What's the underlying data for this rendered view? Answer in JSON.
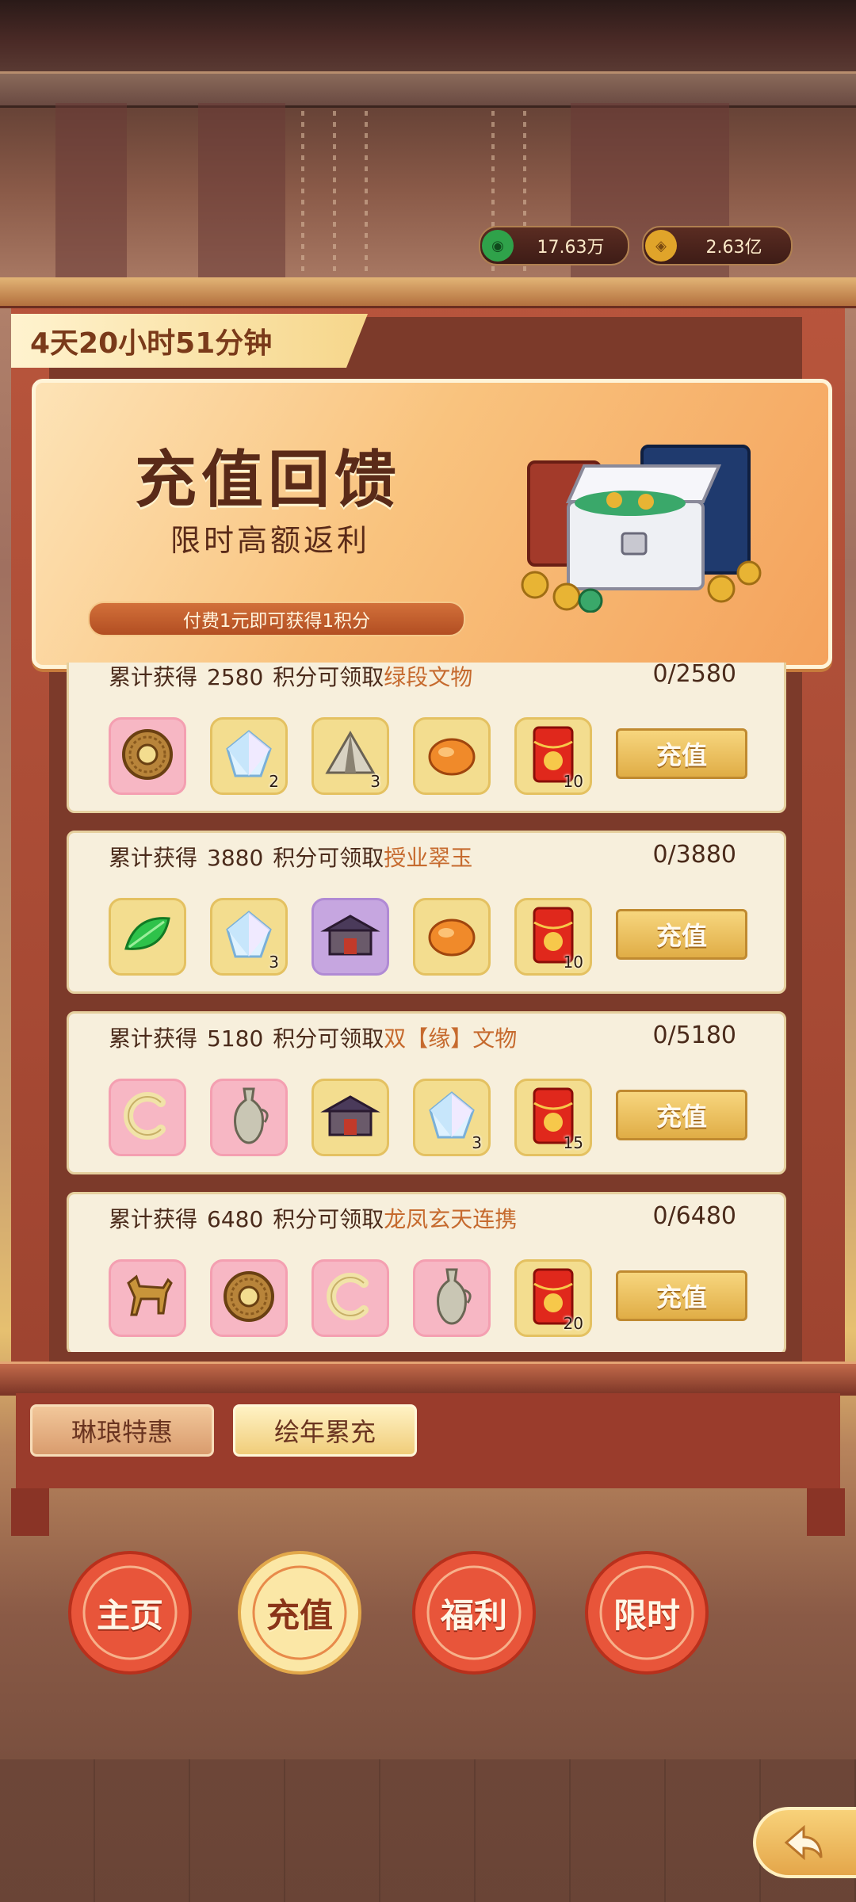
{
  "currencies": [
    {
      "icon": "jade-coin-icon",
      "value": "17.63万",
      "color": "#2fa24a"
    },
    {
      "icon": "gold-coin-icon",
      "value": "2.63亿",
      "color": "#e0a42a"
    }
  ],
  "timer": "4天20小时51分钟",
  "banner": {
    "title": "充值回馈",
    "subtitle": "限时高额返利",
    "rule": "付费1元即可获得1积分"
  },
  "cards": [
    {
      "prefix": "累计获得",
      "points": "2580",
      "mid": "积分可领取",
      "reward": "绿段文物",
      "progress": "0/2580",
      "button": "充值",
      "items": [
        {
          "type": "pink",
          "icon": "bronze-disc-icon",
          "count": ""
        },
        {
          "type": "gold",
          "icon": "crystal-icon",
          "count": "2"
        },
        {
          "type": "gold",
          "icon": "tent-icon",
          "count": "3"
        },
        {
          "type": "gold",
          "icon": "amber-icon",
          "count": ""
        },
        {
          "type": "gold",
          "icon": "red-envelope-icon",
          "count": "10"
        }
      ]
    },
    {
      "prefix": "累计获得",
      "points": "3880",
      "mid": "积分可领取",
      "reward": "授业翠玉",
      "progress": "0/3880",
      "button": "充值",
      "items": [
        {
          "type": "gold",
          "icon": "jade-leaf-icon",
          "count": ""
        },
        {
          "type": "gold",
          "icon": "crystal-icon",
          "count": "3"
        },
        {
          "type": "purple",
          "icon": "building-icon",
          "count": ""
        },
        {
          "type": "gold",
          "icon": "amber-icon",
          "count": ""
        },
        {
          "type": "gold",
          "icon": "red-envelope-icon",
          "count": "10"
        }
      ]
    },
    {
      "prefix": "累计获得",
      "points": "5180",
      "mid": "积分可领取",
      "reward": "双【缘】文物",
      "progress": "0/5180",
      "button": "充值",
      "items": [
        {
          "type": "pink",
          "icon": "jade-ring-icon",
          "count": ""
        },
        {
          "type": "pink",
          "icon": "vase-icon",
          "count": ""
        },
        {
          "type": "gold",
          "icon": "building-icon",
          "count": ""
        },
        {
          "type": "gold",
          "icon": "crystal-icon",
          "count": "3"
        },
        {
          "type": "gold",
          "icon": "red-envelope-icon",
          "count": "15"
        }
      ]
    },
    {
      "prefix": "累计获得",
      "points": "6480",
      "mid": "积分可领取",
      "reward": "龙凤玄天连携",
      "progress": "0/6480",
      "button": "充值",
      "items": [
        {
          "type": "pink",
          "icon": "bronze-horse-icon",
          "count": ""
        },
        {
          "type": "pink",
          "icon": "bronze-disc-icon",
          "count": ""
        },
        {
          "type": "pink",
          "icon": "jade-ring-icon",
          "count": ""
        },
        {
          "type": "pink",
          "icon": "vase-icon",
          "count": ""
        },
        {
          "type": "gold",
          "icon": "red-envelope-icon",
          "count": "20"
        }
      ]
    }
  ],
  "subtabs": [
    {
      "label": "琳琅特惠",
      "active": false
    },
    {
      "label": "绘年累充",
      "active": true
    }
  ],
  "nav": [
    {
      "label": "主页",
      "active": false
    },
    {
      "label": "充值",
      "active": true
    },
    {
      "label": "福利",
      "active": false
    },
    {
      "label": "限时",
      "active": false
    }
  ],
  "back_icon": "back-arrow-icon"
}
